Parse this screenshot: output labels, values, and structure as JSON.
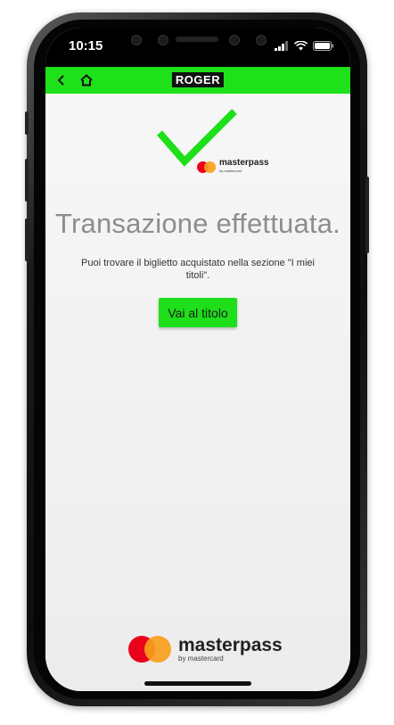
{
  "status_bar": {
    "time": "10:15"
  },
  "nav": {
    "logo": "ROGER",
    "back_icon": "chevron-left-icon",
    "home_icon": "home-icon"
  },
  "confirmation": {
    "headline": "Transazione effettuata.",
    "message": "Puoi trovare il biglietto acquistato nella sezione \"I miei titoli\".",
    "button_label": "Vai al titolo",
    "check_color": "#1edf1a"
  },
  "masterpass": {
    "name": "masterpass",
    "tagline": "by mastercard",
    "red": "#eb001b",
    "orange": "#f79e1b"
  },
  "colors": {
    "nav_green": "#1ee11a",
    "button_green": "#1edf1a",
    "headline_gray": "#8d8d8d"
  }
}
